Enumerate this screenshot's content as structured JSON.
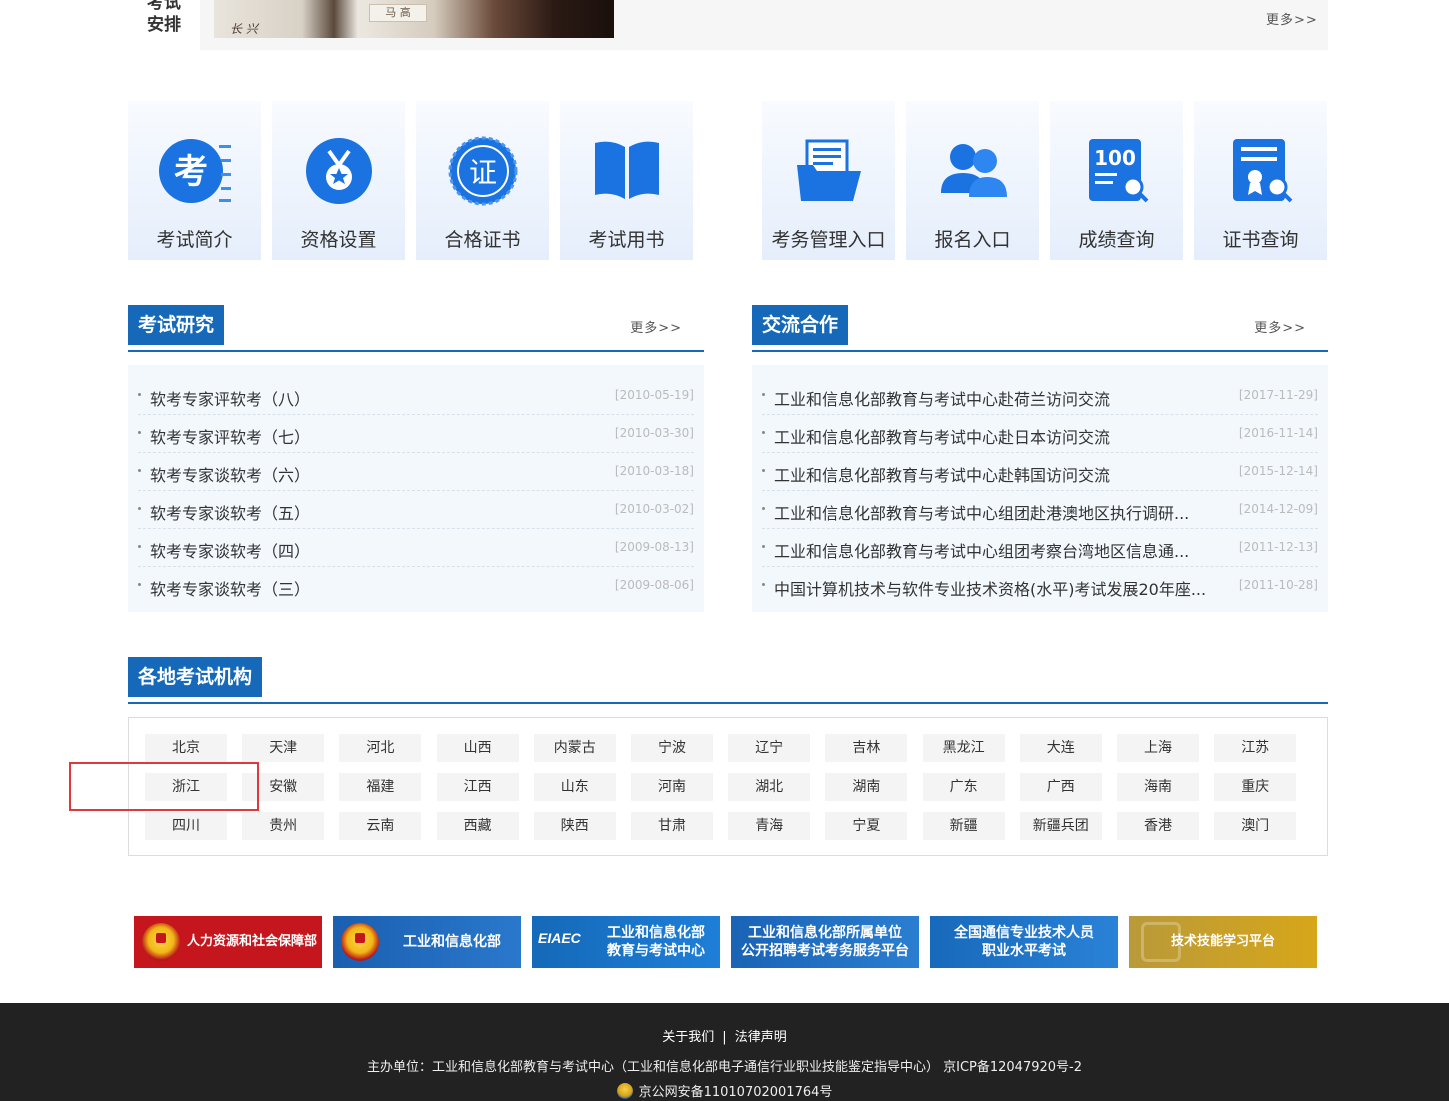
{
  "top": {
    "label_line1": "考试",
    "label_line2": "安排",
    "photo_text_a": "长 兴",
    "photo_text_b": "马 高",
    "more": "更多>>"
  },
  "tiles_left": [
    {
      "label": "考试简介",
      "icon": "exam-intro-icon"
    },
    {
      "label": "资格设置",
      "icon": "medal-icon"
    },
    {
      "label": "合格证书",
      "icon": "certificate-icon"
    },
    {
      "label": "考试用书",
      "icon": "book-icon"
    }
  ],
  "tiles_right": [
    {
      "label": "考务管理入口",
      "icon": "folder-icon"
    },
    {
      "label": "报名入口",
      "icon": "users-icon"
    },
    {
      "label": "成绩查询",
      "icon": "score-search-icon"
    },
    {
      "label": "证书查询",
      "icon": "certificate-search-icon"
    }
  ],
  "research": {
    "title": "考试研究",
    "more": "更多>>",
    "items": [
      {
        "text": "软考专家评软考（八）",
        "date": "[2010-05-19]"
      },
      {
        "text": "软考专家评软考（七）",
        "date": "[2010-03-30]"
      },
      {
        "text": "软考专家谈软考（六）",
        "date": "[2010-03-18]"
      },
      {
        "text": "软考专家谈软考（五）",
        "date": "[2010-03-02]"
      },
      {
        "text": "软考专家谈软考（四）",
        "date": "[2009-08-13]"
      },
      {
        "text": "软考专家谈软考（三）",
        "date": "[2009-08-06]"
      }
    ]
  },
  "cooperation": {
    "title": "交流合作",
    "more": "更多>>",
    "items": [
      {
        "text": "工业和信息化部教育与考试中心赴荷兰访问交流",
        "date": "[2017-11-29]"
      },
      {
        "text": "工业和信息化部教育与考试中心赴日本访问交流",
        "date": "[2016-11-14]"
      },
      {
        "text": "工业和信息化部教育与考试中心赴韩国访问交流",
        "date": "[2015-12-14]"
      },
      {
        "text": "工业和信息化部教育与考试中心组团赴港澳地区执行调研...",
        "date": "[2014-12-09]"
      },
      {
        "text": "工业和信息化部教育与考试中心组团考察台湾地区信息通...",
        "date": "[2011-12-13]"
      },
      {
        "text": "中国计算机技术与软件专业技术资格(水平)考试发展20年座...",
        "date": "[2011-10-28]"
      }
    ]
  },
  "regions": {
    "title": "各地考试机构",
    "rows": [
      [
        "北京",
        "天津",
        "河北",
        "山西",
        "内蒙古",
        "宁波",
        "辽宁",
        "吉林",
        "黑龙江",
        "大连",
        "上海",
        "江苏"
      ],
      [
        "浙江",
        "安徽",
        "福建",
        "江西",
        "山东",
        "河南",
        "湖北",
        "湖南",
        "广东",
        "广西",
        "海南",
        "重庆"
      ],
      [
        "四川",
        "贵州",
        "云南",
        "西藏",
        "陕西",
        "甘肃",
        "青海",
        "宁夏",
        "新疆",
        "新疆兵团",
        "香港",
        "澳门"
      ]
    ]
  },
  "banners": [
    {
      "line1": "人力资源和社会保障部",
      "line2": "",
      "color": "#c4161c"
    },
    {
      "line1": "工业和信息化部",
      "line2": "",
      "color": "#1a5fb0"
    },
    {
      "line1": "工业和信息化部",
      "line2": "教育与考试中心",
      "color": "#1569b8"
    },
    {
      "line1": "工业和信息化部所属单位",
      "line2": "公开招聘考试考务服务平台",
      "color": "#1a63b5"
    },
    {
      "line1": "全国通信专业技术人员",
      "line2": "职业水平考试",
      "color": "#1769bb"
    },
    {
      "line1": "技术技能学习平台",
      "line2": "",
      "color": "#c9a326"
    }
  ],
  "eiaec": "EIAEC",
  "footer": {
    "about": "关于我们",
    "separator": "|",
    "legal": "法律声明",
    "host": "主办单位：工业和信息化部教育与考试中心（工业和信息化部电子通信行业职业技能鉴定指导中心）  京ICP备12047920号-2",
    "police": "京公网安备11010702001764号"
  }
}
